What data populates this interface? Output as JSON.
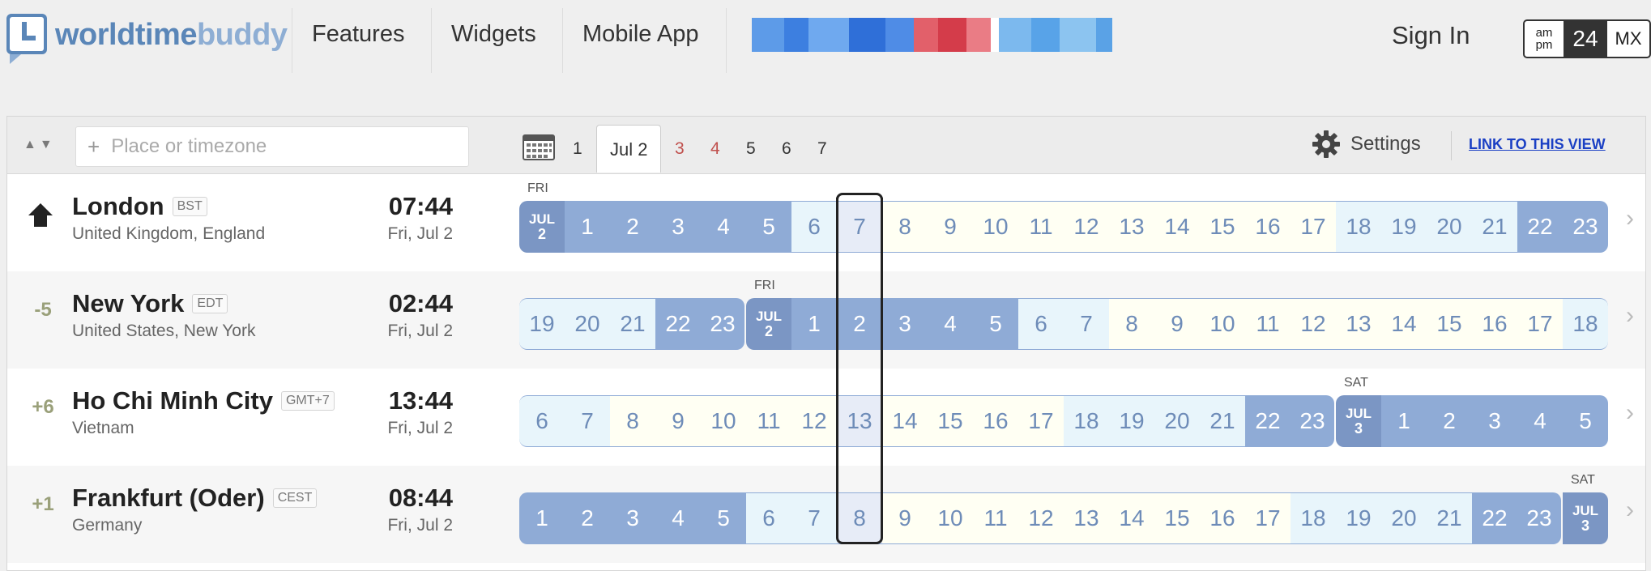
{
  "nav": {
    "logo_part1": "worldtime",
    "logo_part2": "buddy",
    "links": [
      "Features",
      "Widgets",
      "Mobile App"
    ],
    "sign_in": "Sign In",
    "format": {
      "am": "am",
      "pm": "pm",
      "h24": "24",
      "mx": "MX"
    }
  },
  "toolbar": {
    "search_placeholder": "Place or timezone",
    "days": [
      "1",
      "Jul 2",
      "3",
      "4",
      "5",
      "6",
      "7"
    ],
    "settings_label": "Settings",
    "link_label": "LINK TO THIS VIEW"
  },
  "rows": [
    {
      "offset": "",
      "name": "London",
      "abbr": "BST",
      "region": "United Kingdom, England",
      "time": "07:44",
      "date": "Fri, Jul 2",
      "label": "FRI",
      "label_index": 0,
      "cells": [
        "JUL|2",
        "1",
        "2",
        "3",
        "4",
        "5",
        "6",
        "7",
        "8",
        "9",
        "10",
        "11",
        "12",
        "13",
        "14",
        "15",
        "16",
        "17",
        "18",
        "19",
        "20",
        "21",
        "22",
        "23"
      ],
      "kinds": [
        "mid",
        "n",
        "n",
        "n",
        "n",
        "n",
        "t",
        "t",
        "d",
        "d",
        "d",
        "d",
        "d",
        "d",
        "d",
        "d",
        "d",
        "d",
        "t",
        "t",
        "t",
        "t",
        "n",
        "n"
      ]
    },
    {
      "offset": "-5",
      "name": "New York",
      "abbr": "EDT",
      "region": "United States, New York",
      "time": "02:44",
      "date": "Fri, Jul 2",
      "label": "FRI",
      "label_index": 5,
      "cells": [
        "19",
        "20",
        "21",
        "22",
        "23",
        "JUL|2",
        "1",
        "2",
        "3",
        "4",
        "5",
        "6",
        "7",
        "8",
        "9",
        "10",
        "11",
        "12",
        "13",
        "14",
        "15",
        "16",
        "17",
        "18"
      ],
      "kinds": [
        "t",
        "t",
        "t",
        "n",
        "n",
        "mid",
        "n",
        "n",
        "n",
        "n",
        "n",
        "t",
        "t",
        "d",
        "d",
        "d",
        "d",
        "d",
        "d",
        "d",
        "d",
        "d",
        "d",
        "t"
      ]
    },
    {
      "offset": "+6",
      "name": "Ho Chi Minh City",
      "abbr": "GMT+7",
      "region": "Vietnam",
      "time": "13:44",
      "date": "Fri, Jul 2",
      "label": "SAT",
      "label_index": 18,
      "cells": [
        "6",
        "7",
        "8",
        "9",
        "10",
        "11",
        "12",
        "13",
        "14",
        "15",
        "16",
        "17",
        "18",
        "19",
        "20",
        "21",
        "22",
        "23",
        "JUL|3",
        "1",
        "2",
        "3",
        "4",
        "5"
      ],
      "kinds": [
        "t",
        "t",
        "d",
        "d",
        "d",
        "d",
        "d",
        "d",
        "d",
        "d",
        "d",
        "d",
        "t",
        "t",
        "t",
        "t",
        "n",
        "n",
        "mid",
        "n",
        "n",
        "n",
        "n",
        "n"
      ]
    },
    {
      "offset": "+1",
      "name": "Frankfurt (Oder)",
      "abbr": "CEST",
      "region": "Germany",
      "time": "08:44",
      "date": "Fri, Jul 2",
      "label": "SAT",
      "label_index": 23,
      "cells": [
        "1",
        "2",
        "3",
        "4",
        "5",
        "6",
        "7",
        "8",
        "9",
        "10",
        "11",
        "12",
        "13",
        "14",
        "15",
        "16",
        "17",
        "18",
        "19",
        "20",
        "21",
        "22",
        "23",
        "JUL|3"
      ],
      "kinds": [
        "n",
        "n",
        "n",
        "n",
        "n",
        "t",
        "t",
        "d",
        "d",
        "d",
        "d",
        "d",
        "d",
        "d",
        "d",
        "d",
        "d",
        "t",
        "t",
        "t",
        "t",
        "n",
        "n",
        "mid"
      ]
    }
  ],
  "selected_hour_index": 7
}
